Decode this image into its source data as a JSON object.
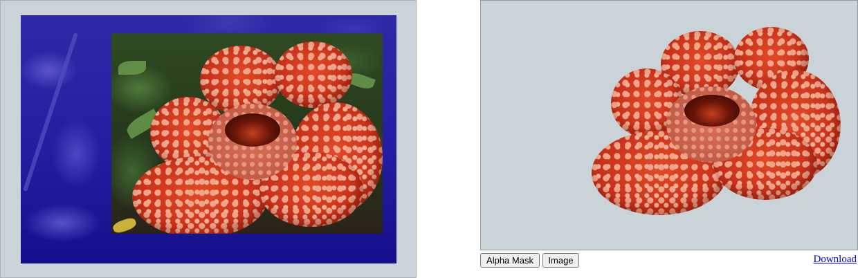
{
  "editor": {
    "canvas_label": "",
    "mask_color": "#1f1a8c"
  },
  "preview": {
    "background": "#cad3d8"
  },
  "controls": {
    "alpha_mask_label": "Alpha Mask",
    "image_label": "Image",
    "download_label": "Download"
  }
}
